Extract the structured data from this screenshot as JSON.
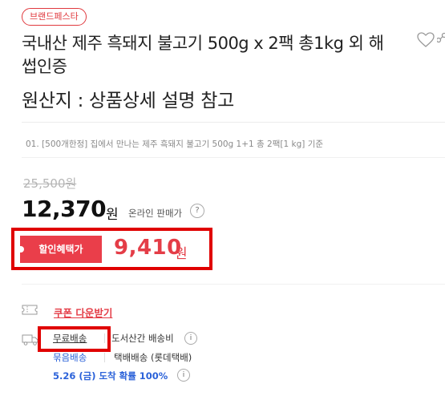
{
  "brand_badge": "브랜드페스타",
  "product": {
    "title": "국내산 제주 흑돼지 불고기 500g x 2팩 총1kg 외 해썹인증",
    "origin": "원산지 : 상품상세 설명 참고",
    "option": "01. [500개한정] 집에서 만나는 제주 흑돼지 불고기 500g 1+1 총 2팩[1 kg] 기준"
  },
  "price": {
    "original": "25,500원",
    "sale": "12,370",
    "sale_unit": "원",
    "online_label": "온라인 판매가",
    "help_glyph": "?"
  },
  "discount": {
    "label": "할인혜택가",
    "price": "9,410",
    "unit": "원"
  },
  "coupon": {
    "label": "쿠폰 다운받기"
  },
  "shipping": {
    "free_label": "무료배송",
    "fee_label": "도서산간 배송비",
    "info_glyph": "i",
    "bundle_label": "묶음배송",
    "courier_label": "택배배송 (롯데택배)",
    "arrival_label": "5.26 (금) 도착 확률 100%"
  },
  "icons": {
    "wishlist": "heart-icon",
    "share": "share-icon",
    "coupon": "ticket-icon",
    "delivery": "truck-icon",
    "help": "question-icon",
    "info": "info-icon"
  },
  "colors": {
    "accent": "#e43d47",
    "discount_chip": "#ea3e4a",
    "link_blue": "#2b62d9",
    "highlight_box": "#e00000"
  }
}
